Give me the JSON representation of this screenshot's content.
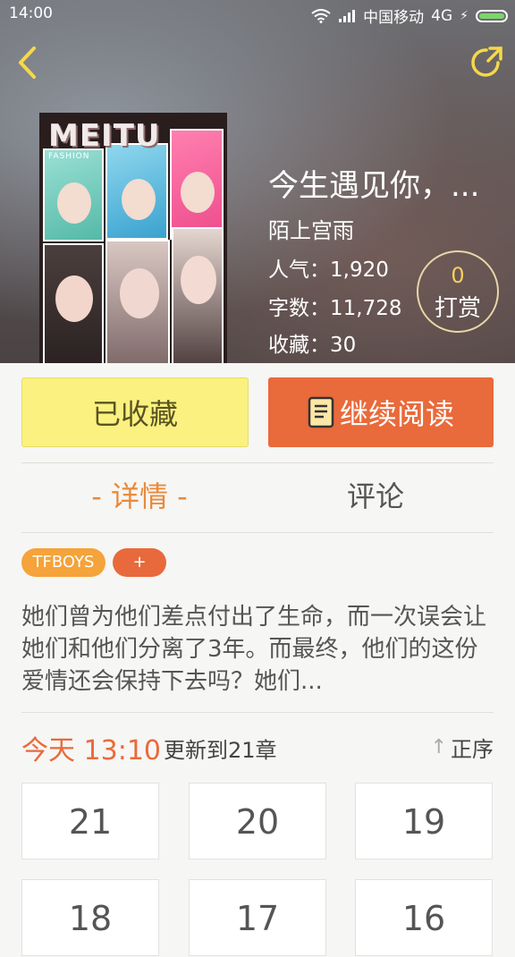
{
  "status_bar": {
    "time": "14:00",
    "carrier": "中国移动",
    "network": "4G",
    "icons": [
      "wifi-icon",
      "signal-icon",
      "charging-icon",
      "battery-icon"
    ]
  },
  "header": {
    "back_icon": "back-arrow-icon",
    "share_icon": "share-icon"
  },
  "book": {
    "title": "今生遇见你，...",
    "author": "陌上宫雨",
    "popularity": "人气：1,920",
    "word_count": "字数：11,728",
    "favorites": "收藏：30",
    "tip_count": "0",
    "tip_label": "打赏",
    "cover": {
      "brand": "MEITU",
      "sub": "FASHION"
    }
  },
  "actions": {
    "collected_label": "已收藏",
    "continue_label": "继续阅读"
  },
  "tabs": [
    {
      "label": "- 详情 -",
      "active": true
    },
    {
      "label": "评论",
      "active": false
    }
  ],
  "tags": [
    "TFBOYS",
    "+"
  ],
  "description": "她们曾为他们差点付出了生命，而一次误会让她们和他们分离了3年。而最终，他们的这份爱情还会保持下去吗？她们...",
  "update": {
    "time": "今天 13:10",
    "text": "更新到21章",
    "sort_label": "正序"
  },
  "chapters": [
    "21",
    "20",
    "19",
    "18",
    "17",
    "16"
  ],
  "colors": {
    "accent_orange": "#e96a3b",
    "tab_active": "#ea8a3a",
    "collected_bg": "#fbf180",
    "tag_bg": "#f5a33a"
  }
}
